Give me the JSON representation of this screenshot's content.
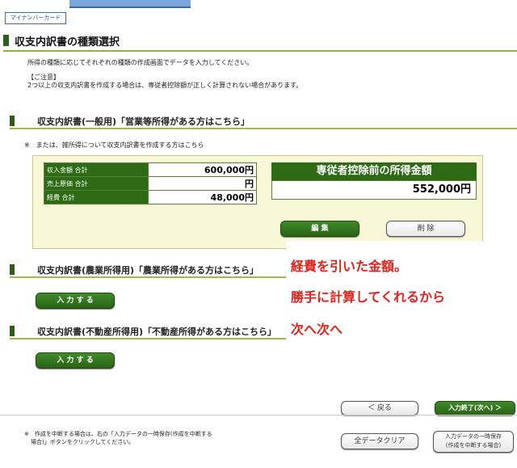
{
  "header": {
    "mynumber_label": "マイナンバーカード",
    "page_title": "収支内訳書の種類選択"
  },
  "intro": {
    "instruction": "所得の種類に応じてそれぞれの種類の作成画面でデータを入力してください。",
    "notice_title": "【ご注意】",
    "notice_text": "2つ以上の収支内訳書を作成する場合は、専従者控除額が正しく計算されない場合があります。"
  },
  "general": {
    "title": "収支内訳書(一般用)「営業等所得がある方はこちら」",
    "note": "※　または、雑所得について収支内訳書を作成する方はこちら",
    "rows": [
      {
        "label": "収入金額 合計",
        "value": "600,000円"
      },
      {
        "label": "売上原価 合計",
        "value": "円"
      },
      {
        "label": "経費 合計",
        "value": "48,000円"
      }
    ],
    "deduction_label": "専従者控除前の所得金額",
    "deduction_value": "552,000円",
    "edit_label": "編 集",
    "delete_label": "削 除"
  },
  "agri": {
    "title": "収支内訳書(農業所得用)「農業所得がある方はこちら」",
    "input_label": "入 力 す る"
  },
  "realestate": {
    "title": "収支内訳書(不動産所得用)「不動産所得がある方はこちら」",
    "input_label": "入 力 す る"
  },
  "annotation": {
    "line1": "経費を引いた金額。",
    "line2": "勝手に計算してくれるから",
    "line3": "次へ次へ"
  },
  "nav": {
    "back_label": "＜ 戻る",
    "next_label": "入力終了(次へ) ＞"
  },
  "footer": {
    "note_line1": "※　作成を中断する場合は、右の「入力データの一時保存(作成を中断する",
    "note_line2": "場合)」ボタンをクリックしてください。",
    "clear_label": "全データクリア",
    "save_line1": "入力データの一時保存",
    "save_line2": "(作成を中断する場合)"
  },
  "colors": {
    "accent_green": "#2e6b15",
    "annotation_red": "#e8201a"
  }
}
